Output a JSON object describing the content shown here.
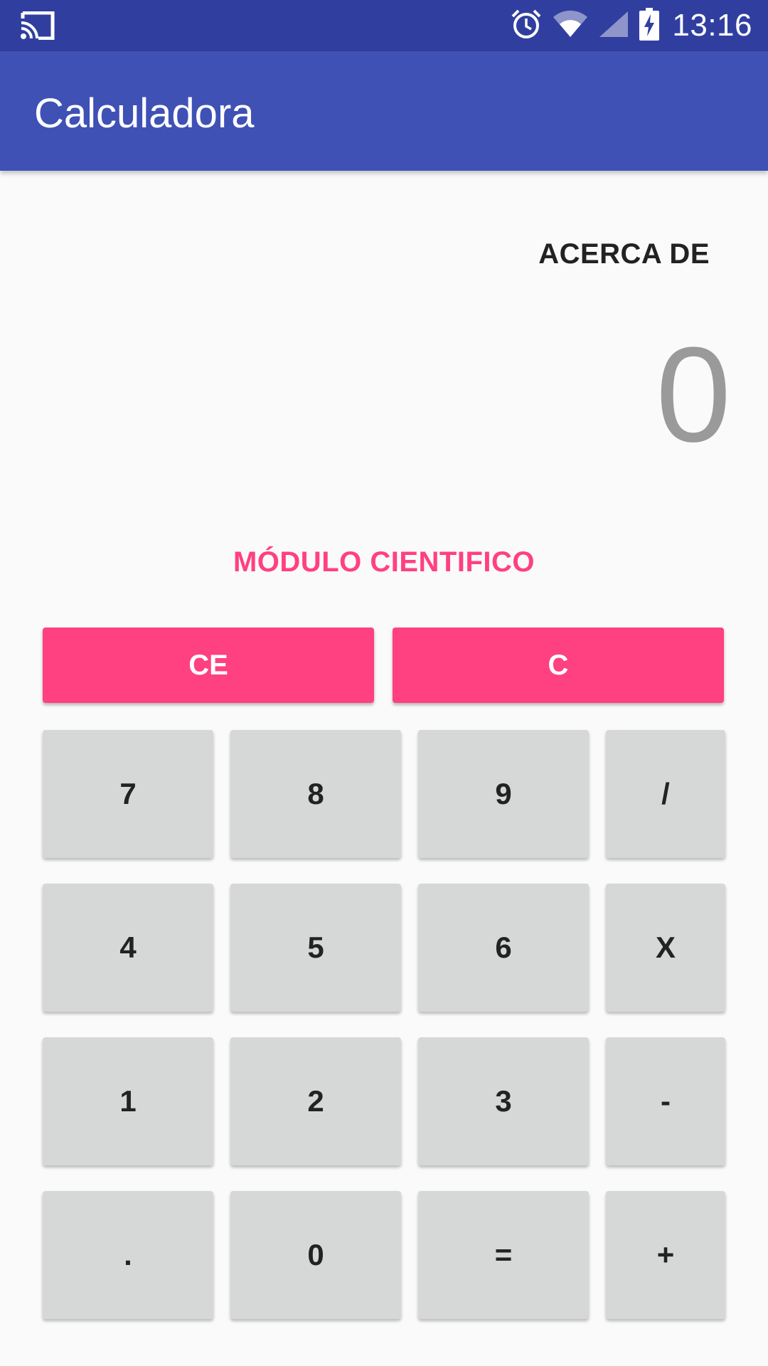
{
  "status_bar": {
    "time": "13:16",
    "icons": [
      "cast-icon",
      "alarm-icon",
      "wifi-icon",
      "cell-signal-icon",
      "battery-charging-icon"
    ]
  },
  "app_bar": {
    "title": "Calculadora"
  },
  "about_label": "ACERCA DE",
  "display_value": "0",
  "scientific_label": "MÓDULO CIENTIFICO",
  "clear_buttons": {
    "ce": "CE",
    "c": "C"
  },
  "keypad": [
    [
      "7",
      "8",
      "9",
      "/"
    ],
    [
      "4",
      "5",
      "6",
      "X"
    ],
    [
      "1",
      "2",
      "3",
      "-"
    ],
    [
      ".",
      "0",
      "=",
      "+"
    ]
  ],
  "colors": {
    "status_bar": "#303f9f",
    "app_bar": "#3f51b5",
    "accent": "#ff4081",
    "key_bg": "#d6d7d7",
    "background": "#fafafa",
    "display_text": "#9a9a9a"
  }
}
